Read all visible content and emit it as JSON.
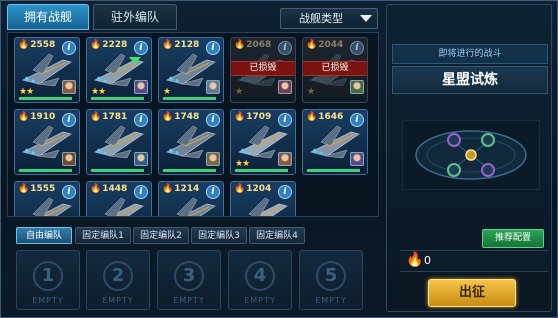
{
  "tabs": {
    "owned": "拥有战舰",
    "external": "驻外编队"
  },
  "filter": {
    "label": "战舰类型"
  },
  "ships": [
    {
      "power": "2558",
      "stars": "★★",
      "hp": 0.95,
      "damaged": false
    },
    {
      "power": "2228",
      "stars": "★★",
      "hp": 0.95,
      "damaged": false
    },
    {
      "power": "2128",
      "stars": "★",
      "hp": 0.95,
      "damaged": false
    },
    {
      "power": "2068",
      "stars": "★",
      "hp": 0,
      "damaged": true
    },
    {
      "power": "2044",
      "stars": "★",
      "hp": 0,
      "damaged": true
    },
    {
      "power": "1910",
      "stars": "",
      "hp": 0.95,
      "damaged": false
    },
    {
      "power": "1781",
      "stars": "",
      "hp": 0.95,
      "damaged": false
    },
    {
      "power": "1748",
      "stars": "",
      "hp": 0.95,
      "damaged": false
    },
    {
      "power": "1709",
      "stars": "★★",
      "hp": 0.95,
      "damaged": false
    },
    {
      "power": "1646",
      "stars": "",
      "hp": 0.95,
      "damaged": false
    },
    {
      "power": "1555",
      "stars": "",
      "hp": 0.95,
      "damaged": false
    },
    {
      "power": "1448",
      "stars": "",
      "hp": 0.95,
      "damaged": false
    },
    {
      "power": "1214",
      "stars": "",
      "hp": 0.95,
      "damaged": false
    },
    {
      "power": "1204",
      "stars": "",
      "hp": 0.95,
      "damaged": false
    }
  ],
  "damaged_label": "已损毁",
  "fleet_tabs": [
    "自由编队",
    "固定编队1",
    "固定编队2",
    "固定编队3",
    "固定编队4"
  ],
  "slots": [
    {
      "num": "1",
      "label": "EMPTY"
    },
    {
      "num": "2",
      "label": "EMPTY"
    },
    {
      "num": "3",
      "label": "EMPTY"
    },
    {
      "num": "4",
      "label": "EMPTY"
    },
    {
      "num": "5",
      "label": "EMPTY"
    }
  ],
  "battle": {
    "subtitle": "即将进行的战斗",
    "name": "星盟试炼",
    "recommend_label": "推荐配置",
    "total_power": "0",
    "launch_label": "出征"
  },
  "colors": {
    "accent": "#2c93c9",
    "hp_green": "#3ad17a",
    "damaged_red": "#7a1412",
    "launch_gold": "#f5c54a"
  }
}
